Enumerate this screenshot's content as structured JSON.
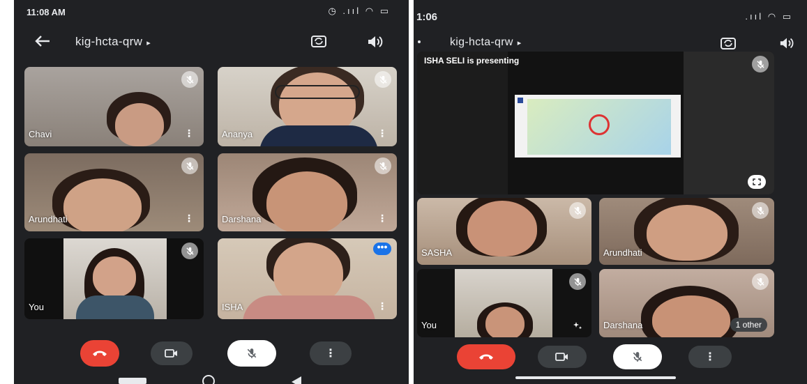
{
  "left": {
    "time": "11:08 AM",
    "status_icons": "◷ .ııl ◠ ▭",
    "meeting_code": "kig-hcta-qrw",
    "caret": "▸",
    "participants": [
      {
        "name": "Chavi"
      },
      {
        "name": "Ananya"
      },
      {
        "name": "Arundhati"
      },
      {
        "name": "Darshana"
      },
      {
        "name": "You"
      },
      {
        "name": "ISHA"
      }
    ],
    "more_dots": "⋮",
    "badge_more": "•••"
  },
  "right": {
    "time": "1:06",
    "status_icons": ".ııl ◠ ▭",
    "meeting_code": "kig-hcta-qrw",
    "caret": "▸",
    "presenting_text": "ISHA SELI is presenting",
    "participants": [
      {
        "name": "SASHA"
      },
      {
        "name": "Arundhati"
      },
      {
        "name": "You"
      },
      {
        "name": "Darshana"
      }
    ],
    "others_label": "1 other"
  },
  "colors": {
    "background": "#202124",
    "end_call": "#ea4335",
    "control_dark": "#3c4043",
    "accent_blue": "#1a73e8"
  },
  "icons": [
    "back-arrow-icon",
    "flip-camera-icon",
    "speaker-icon",
    "mic-off-icon",
    "end-call-icon",
    "camera-icon",
    "more-icon",
    "fullscreen-icon",
    "effects-icon"
  ]
}
